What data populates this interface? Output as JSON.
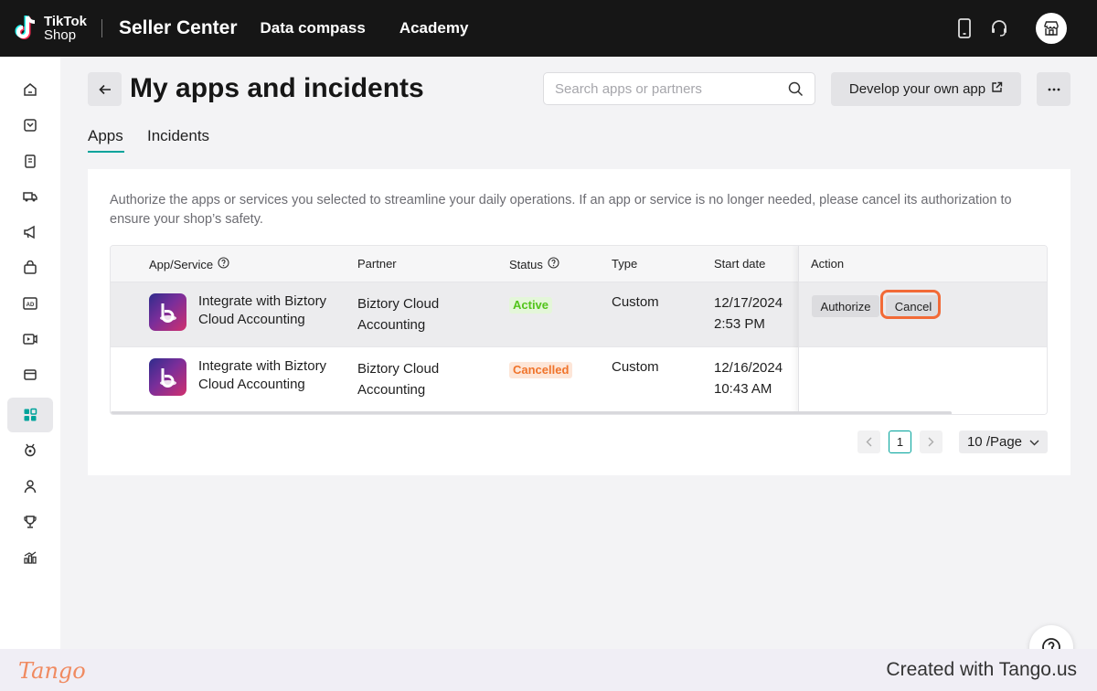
{
  "topbar": {
    "logo_line1": "TikTok",
    "logo_line2": "Shop",
    "title": "Seller Center",
    "links": [
      "Data compass",
      "Academy"
    ]
  },
  "sidebar": {
    "items": [
      "home-icon",
      "inbox-icon",
      "orders-icon",
      "shipping-icon",
      "marketing-icon",
      "products-icon",
      "ads-icon",
      "video-icon",
      "finance-icon",
      "apps-icon",
      "growth-icon",
      "account-icon",
      "rewards-icon",
      "analytics-icon"
    ],
    "active_index": 9
  },
  "header": {
    "title": "My apps and incidents",
    "search_placeholder": "Search apps or partners",
    "develop_button": "Develop your own app"
  },
  "tabs": [
    {
      "label": "Apps",
      "active": true
    },
    {
      "label": "Incidents",
      "active": false
    }
  ],
  "card": {
    "description": "Authorize the apps or services you selected to streamline your daily operations. If an app or service is no longer needed, please cancel its authorization to ensure your shop’s safety."
  },
  "table": {
    "columns": [
      "App/Service",
      "Partner",
      "Status",
      "Type",
      "Start date",
      "Action"
    ],
    "rows": [
      {
        "name": "Integrate with Biztory Cloud Accounting",
        "partner": "Biztory Cloud Accounting",
        "status": "Active",
        "type": "Custom",
        "date": "12/17/2024",
        "time": "2:53 PM",
        "actions": [
          "Authorize",
          "Cancel"
        ]
      },
      {
        "name": "Integrate with Biztory Cloud Accounting",
        "partner": "Biztory Cloud Accounting",
        "status": "Cancelled",
        "type": "Custom",
        "date": "12/16/2024",
        "time": "10:43 AM",
        "actions": []
      }
    ]
  },
  "pagination": {
    "current_page": "1",
    "page_size": "10 /Page"
  },
  "footer": {
    "brand": "Tango",
    "credit": "Created with Tango.us"
  },
  "colors": {
    "accent": "#00a39b",
    "highlight": "#f26a37",
    "active_status": "#52c41a",
    "cancelled_status": "#f0742b"
  }
}
